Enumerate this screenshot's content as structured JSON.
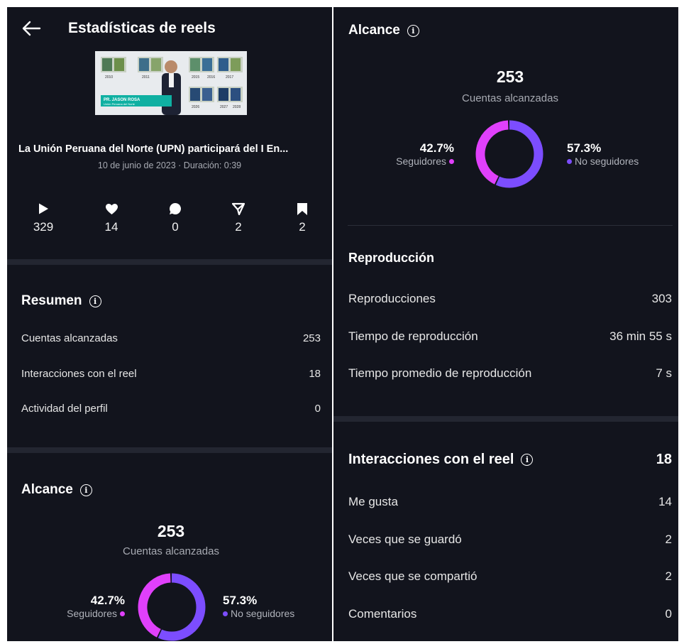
{
  "header": {
    "title": "Estadísticas de reels"
  },
  "video": {
    "thumbnail_years": [
      "2010",
      "2011",
      "2015",
      "2016",
      "2017",
      "2026",
      "2027",
      "2028"
    ],
    "thumbnail_caption_line1": "PR. JASON ROSA",
    "thumbnail_caption_line2": "Unión Peruana del Norte",
    "title": "La Unión Peruana del Norte (UPN) participará del I En...",
    "meta": "10 de junio de 2023 · Duración: 0:39"
  },
  "stats": [
    {
      "icon": "play-icon",
      "value": "329"
    },
    {
      "icon": "heart-icon",
      "value": "14"
    },
    {
      "icon": "comment-icon",
      "value": "0"
    },
    {
      "icon": "share-icon",
      "value": "2"
    },
    {
      "icon": "bookmark-icon",
      "value": "2"
    }
  ],
  "summary": {
    "title": "Resumen",
    "rows": [
      {
        "label": "Cuentas alcanzadas",
        "value": "253"
      },
      {
        "label": "Interacciones con el reel",
        "value": "18"
      },
      {
        "label": "Actividad del perfil",
        "value": "0"
      }
    ]
  },
  "reach": {
    "title": "Alcance",
    "total": "253",
    "total_label": "Cuentas alcanzadas",
    "followers_pct": "42.7%",
    "followers_label": "Seguidores",
    "followers_fraction": 0.427,
    "non_followers_pct": "57.3%",
    "non_followers_label": "No seguidores",
    "followers_color": "#e040fb",
    "non_followers_color": "#7c4dff"
  },
  "playback": {
    "title": "Reproducción",
    "rows": [
      {
        "label": "Reproducciones",
        "value": "303"
      },
      {
        "label": "Tiempo de reproducción",
        "value": "36 min 55 s"
      },
      {
        "label": "Tiempo promedio de reproducción",
        "value": "7 s"
      }
    ]
  },
  "interactions": {
    "title": "Interacciones con el reel",
    "total": "18",
    "rows": [
      {
        "label": "Me gusta",
        "value": "14"
      },
      {
        "label": "Veces que se guardó",
        "value": "2"
      },
      {
        "label": "Veces que se compartió",
        "value": "2"
      },
      {
        "label": "Comentarios",
        "value": "0"
      }
    ]
  }
}
